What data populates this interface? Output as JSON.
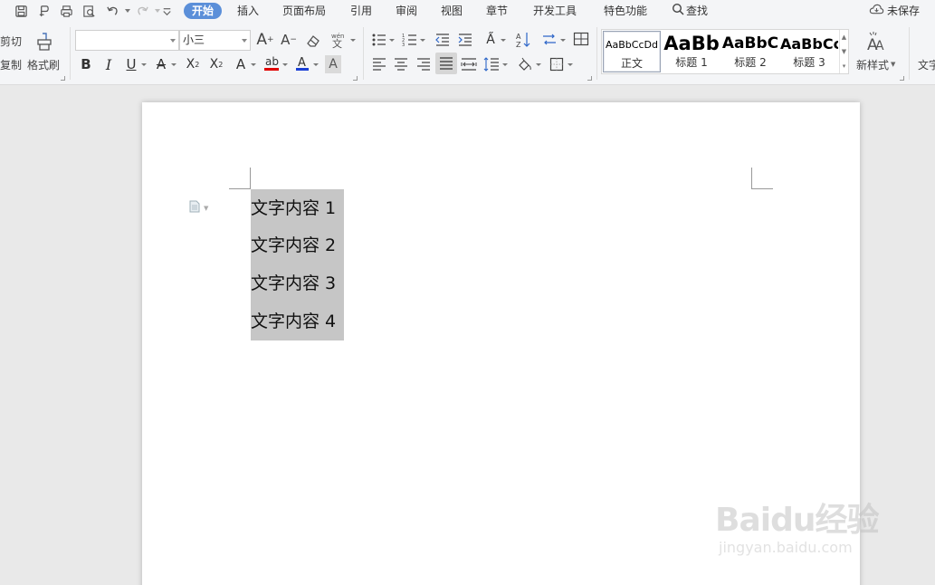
{
  "menu": {
    "tabs": [
      "开始",
      "插入",
      "页面布局",
      "引用",
      "审阅",
      "视图",
      "章节",
      "开发工具",
      "特色功能"
    ],
    "active_tab": "开始",
    "search_label": "查找",
    "save_status": "未保存"
  },
  "ribbon": {
    "clipboard": {
      "cut": "剪切",
      "copy": "复制",
      "format_painter": "格式刷"
    },
    "font": {
      "name_value": "",
      "size_value": "小三"
    },
    "styles": [
      {
        "sample": "AaBbCcDd",
        "name": "正文"
      },
      {
        "sample": "AaBb",
        "name": "标题 1"
      },
      {
        "sample": "AaBbC",
        "name": "标题 2"
      },
      {
        "sample": "AaBbCc",
        "name": "标题 3"
      }
    ],
    "new_style": "新样式",
    "text_tools": "文字"
  },
  "document": {
    "paragraphs": [
      "文字内容 1",
      "文字内容 2",
      "文字内容 3",
      "文字内容 4"
    ]
  },
  "watermark": {
    "logo": "Baidu经验",
    "url": "jingyan.baidu.com"
  },
  "colors": {
    "active_tab": "#5b8fd9",
    "selection": "#c6c6c6",
    "font_color_red": "#e00000",
    "font_color_blue": "#1a3fd6"
  }
}
